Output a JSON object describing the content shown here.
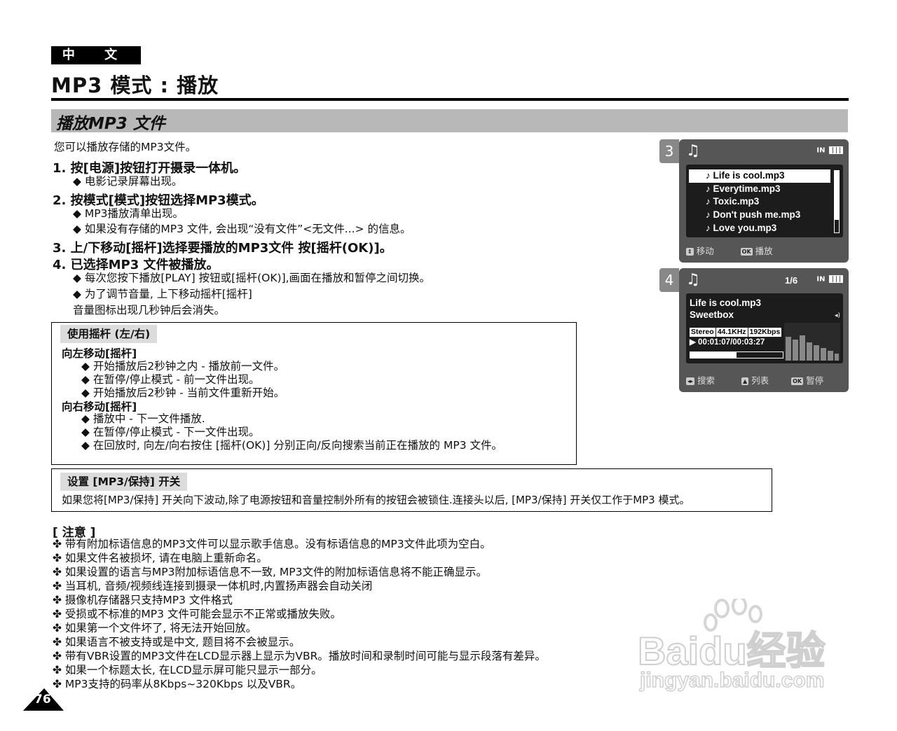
{
  "header": {
    "lang_tab": "中 文",
    "page_title": "MP3 模式 : 播放",
    "section_title": "播放MP3 文件"
  },
  "intro": "您可以播放存储的MP3文件。",
  "steps": [
    {
      "title": "1. 按[电源]按钮打开摄录一体机。",
      "bullets": [
        "◆  电影记录屏幕出现。"
      ]
    },
    {
      "title": "2. 按模式[模式]按钮选择MP3模式。",
      "bullets": [
        "◆  MP3播放清单出现。",
        "◆  如果没有存储的MP3 文件, 会出现“没有文件”<无文件...> 的信息。"
      ]
    },
    {
      "title": "3. 上/下移动[摇杆]选择要播放的MP3文件 按[摇杆(OK)]。",
      "bullets": []
    },
    {
      "title": "4. 已选择MP3 文件被播放。",
      "bullets": [
        "◆  每次您按下播放[PLAY] 按钮或[摇杆(OK)],画面在播放和暂停之间切换。",
        "◆  为了调节音量, 上下移动摇杆[摇杆]",
        "    音量图标出现几秒钟后会消失。"
      ]
    }
  ],
  "joystick_box": {
    "head": "使用摇杆 (左/右)",
    "left_head": "向左移动[摇杆]",
    "left_items": [
      "◆  开始播放后2秒钟之内 - 播放前一文件。",
      "◆  在暂停/停止模式 - 前一文件出现。",
      "◆  开始播放后2秒钟 - 当前文件重新开始。"
    ],
    "right_head": "向右移动[摇杆]",
    "right_items": [
      "◆  播放中 - 下一文件播放.",
      "◆  在暂停/停止模式 - 下一文件出现。",
      "◆  在回放时, 向左/向右按住 [摇杆(OK)] 分别正向/反向搜索当前正在播放的 MP3 文件。"
    ]
  },
  "hold_box": {
    "head": "设置 [MP3/保持] 开关",
    "text": "如果您将[MP3/保持] 开关向下波动,除了电源按钮和音量控制外所有的按钮会被锁住.连接头以后, [MP3/保持] 开关仅工作于MP3 模式。"
  },
  "lcd3": {
    "num": "3",
    "status": "IN",
    "files": [
      "Life is cool.mp3",
      "Everytime.mp3",
      "Toxic.mp3",
      "Don't push me.mp3",
      "Love you.mp3"
    ],
    "selected_index": 0,
    "foot_move": "移动",
    "foot_play": "播放",
    "key_ok": "OK"
  },
  "lcd4": {
    "num": "4",
    "counter": "1/6",
    "status": "IN",
    "song": "Life is cool.mp3",
    "artist": "Sweetbox",
    "tags": [
      "Stereo",
      "44.1KHz",
      "192Kbps"
    ],
    "time": "00:01:07/00:03:27",
    "progress": 0.5,
    "foot_search": "搜索",
    "foot_list": "列表",
    "foot_pause": "暂停",
    "key_ok": "OK"
  },
  "notes": {
    "title": "[ 注意 ]",
    "items": [
      "带有附加标语信息的MP3文件可以显示歌手信息。没有标语信息的MP3文件此项为空白。",
      "如果文件名被损坏, 请在电脑上重新命名。",
      "如果设置的语言与MP3附加标语信息不一致, MP3文件的附加标语信息将不能正确显示。",
      "当耳机, 音频/视频线连接到摄录一体机时,内置扬声器会自动关闭",
      "摄像机存储器只支持MP3 文件格式",
      "受损或不标准的MP3 文件可能会显示不正常或播放失败。",
      "如果第一个文件坏了, 将无法开始回放。",
      "如果语言不被支持或是中文, 题目将不会被显示。",
      "带有VBR设置的MP3文件在LCD显示器上显示为VBR。播放时间和录制时间可能与显示段落有差异。",
      "如果一个标题太长, 在LCD显示屏可能只显示一部分。",
      "MP3支持的码率从8Kbps~320Kbps 以及VBR。"
    ]
  },
  "page_number": "76",
  "watermark": {
    "brand": "Baidu经验",
    "url": "jingyan.baidu.com"
  },
  "colors": {
    "section_bar": "#b8b8b8",
    "lcd_body": "#565656",
    "lcd_screen": "#1c1c1c"
  }
}
